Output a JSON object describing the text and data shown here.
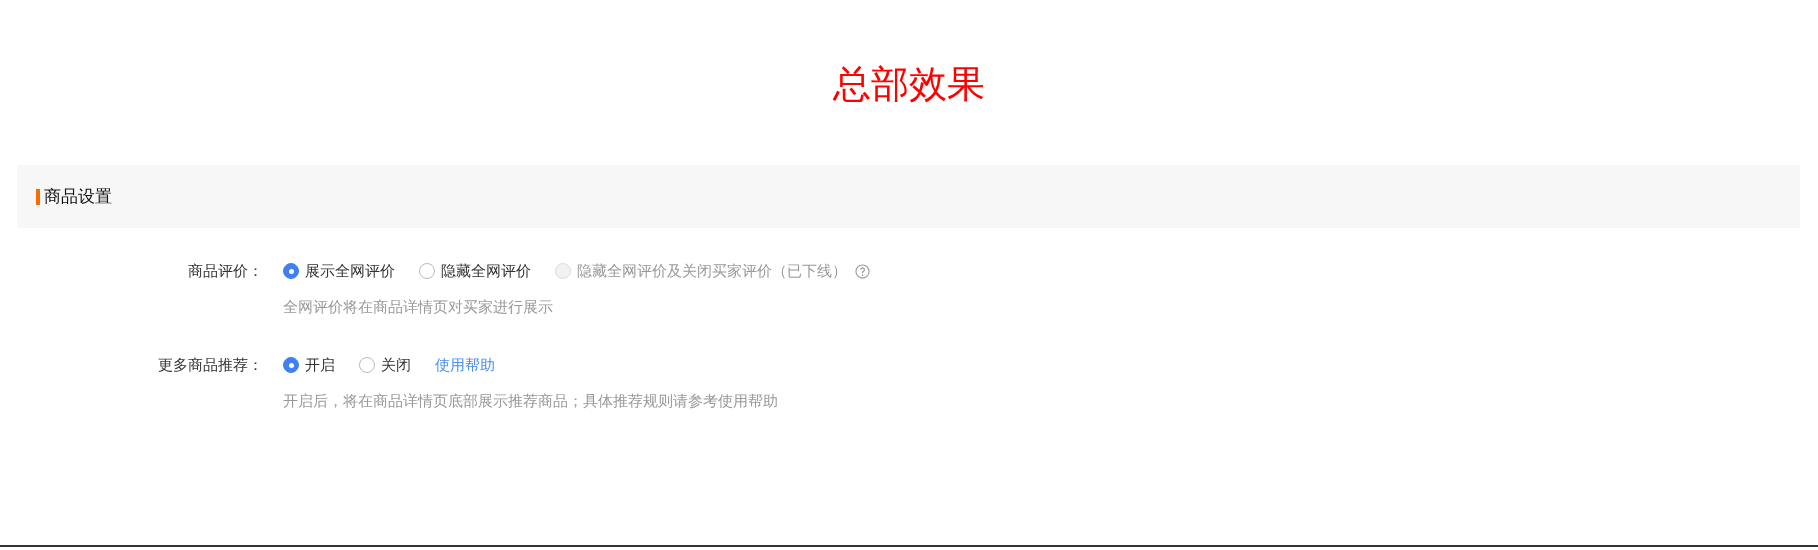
{
  "page_title": "总部效果",
  "section": {
    "title": "商品设置"
  },
  "fields": [
    {
      "label": "商品评价：",
      "options": [
        {
          "label": "展示全网评价",
          "selected": true,
          "disabled": false,
          "help": false
        },
        {
          "label": "隐藏全网评价",
          "selected": false,
          "disabled": false,
          "help": false
        },
        {
          "label": "隐藏全网评价及关闭买家评价（已下线）",
          "selected": false,
          "disabled": true,
          "help": true
        }
      ],
      "hint": "全网评价将在商品详情页对买家进行展示"
    },
    {
      "label": "更多商品推荐：",
      "options": [
        {
          "label": "开启",
          "selected": true,
          "disabled": false,
          "help": false
        },
        {
          "label": "关闭",
          "selected": false,
          "disabled": false,
          "help": false
        }
      ],
      "link": "使用帮助",
      "hint": "开启后，将在商品详情页底部展示推荐商品；具体推荐规则请参考使用帮助"
    }
  ]
}
